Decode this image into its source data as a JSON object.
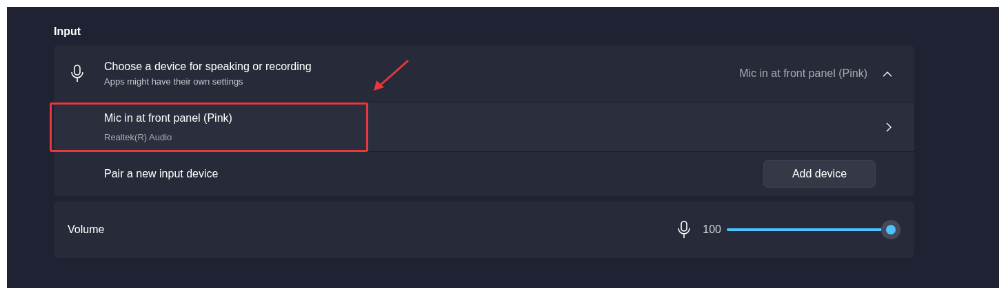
{
  "section_title": "Input",
  "device_chooser": {
    "title": "Choose a device for speaking or recording",
    "subtitle": "Apps might have their own settings",
    "current": "Mic in at front panel (Pink)",
    "expanded": true
  },
  "devices": [
    {
      "name": "Mic in at front panel (Pink)",
      "detail": "Realtek(R) Audio",
      "highlighted": true
    }
  ],
  "pair": {
    "label": "Pair a new input device",
    "button": "Add device"
  },
  "volume": {
    "label": "Volume",
    "reading": "100",
    "level": 1.0
  }
}
